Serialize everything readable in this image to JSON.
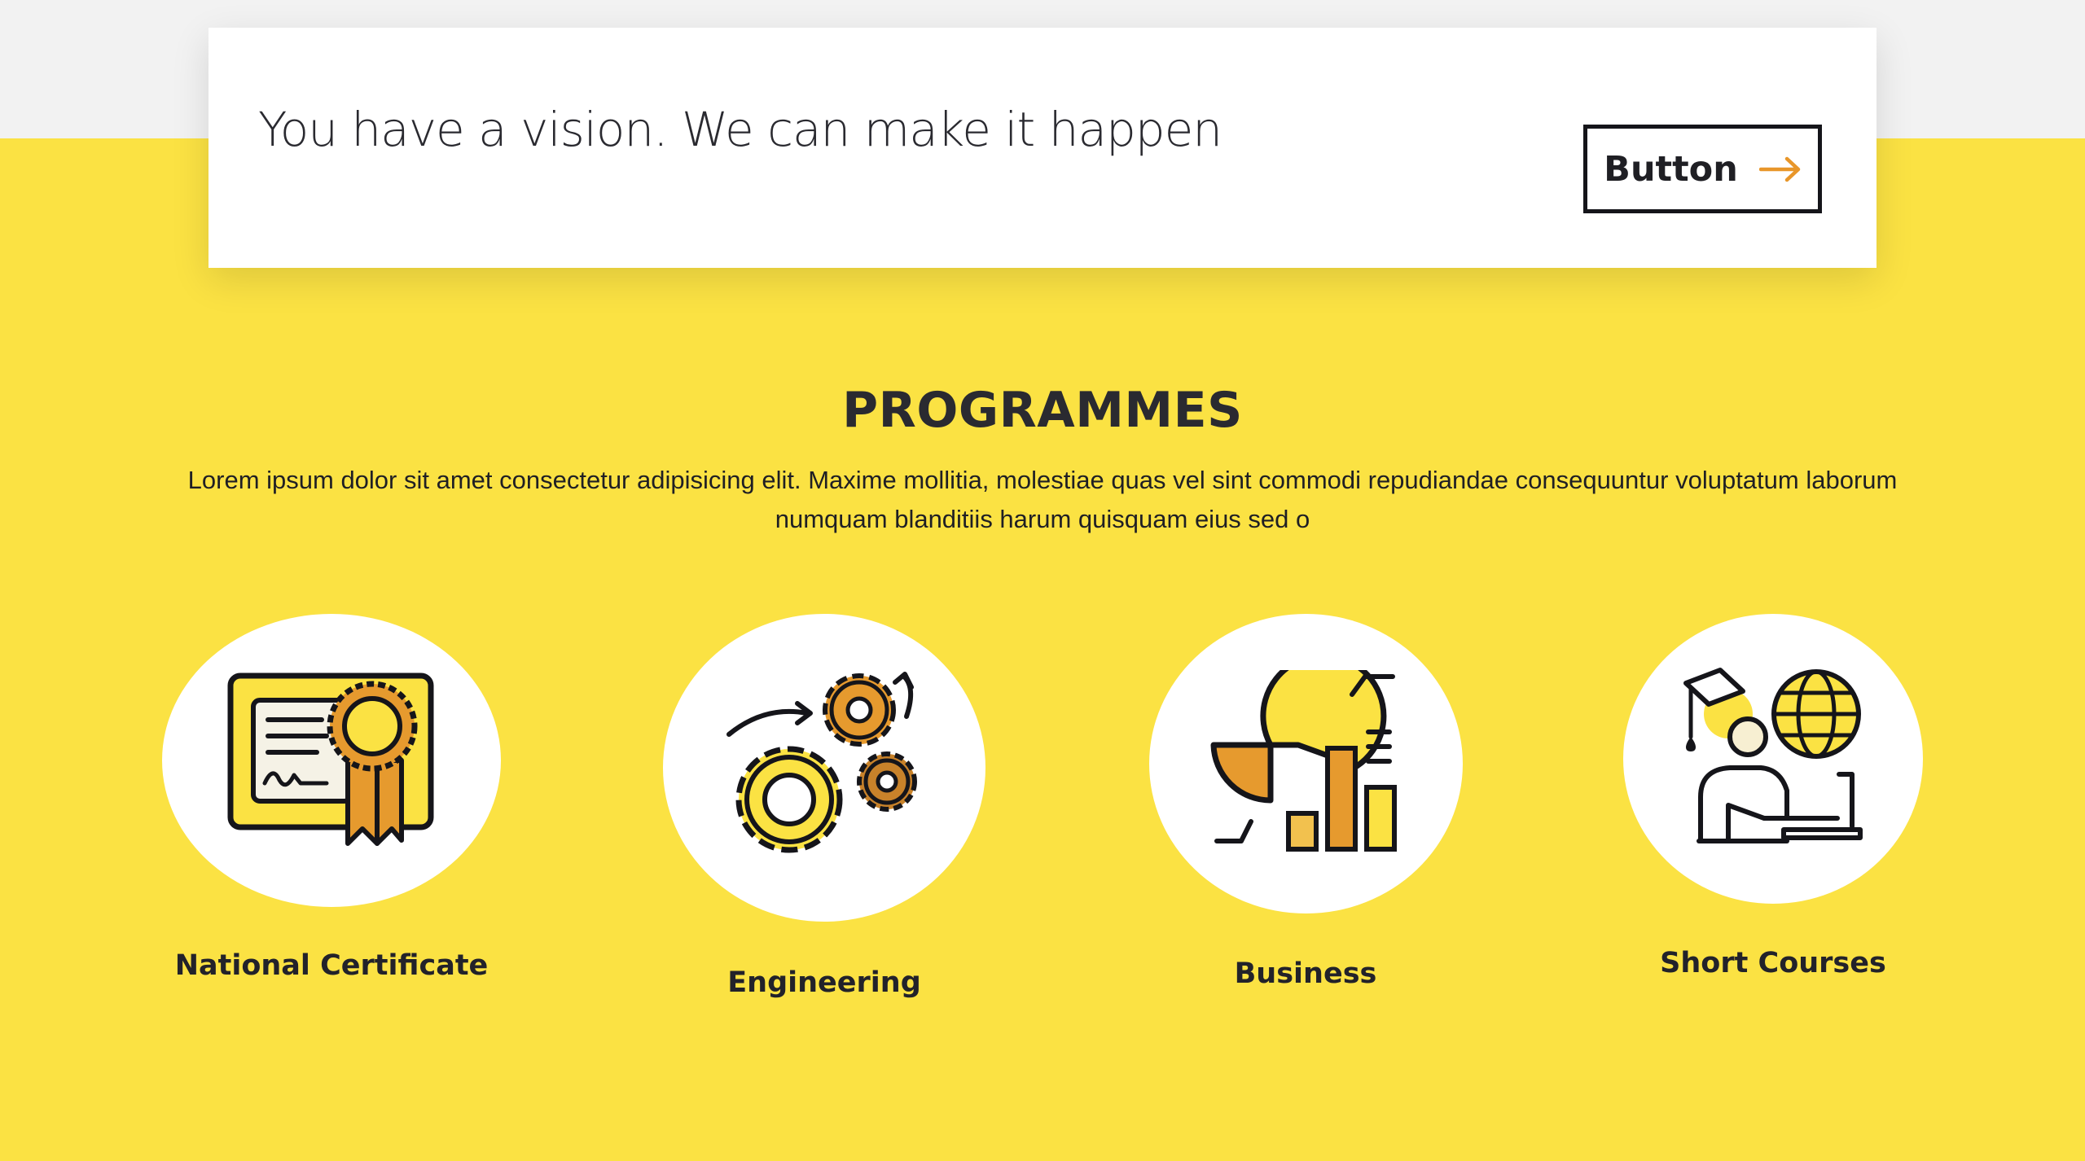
{
  "cta": {
    "headline": "You have a vision. We can make it happen",
    "button_label": "Button",
    "button_icon": "arrow-right-icon",
    "arrow_color": "#e8962a"
  },
  "section": {
    "title": "PROGRAMMES",
    "description": "Lorem ipsum dolor sit amet consectetur adipisicing elit. Maxime mollitia, molestiae quas vel sint commodi repudiandae consequuntur voluptatum laborum numquam blanditiis harum quisquam eius sed o"
  },
  "programmes": [
    {
      "label": "National Certificate",
      "icon": "certificate-icon"
    },
    {
      "label": "Engineering",
      "icon": "gears-icon"
    },
    {
      "label": "Business",
      "icon": "business-chart-icon"
    },
    {
      "label": "Short Courses",
      "icon": "online-learning-icon"
    }
  ],
  "colors": {
    "background_yellow": "#fbe243",
    "top_band": "#f2f2f2",
    "accent_orange": "#e69a2e",
    "icon_yellow": "#fbe243",
    "outline": "#15151a"
  }
}
